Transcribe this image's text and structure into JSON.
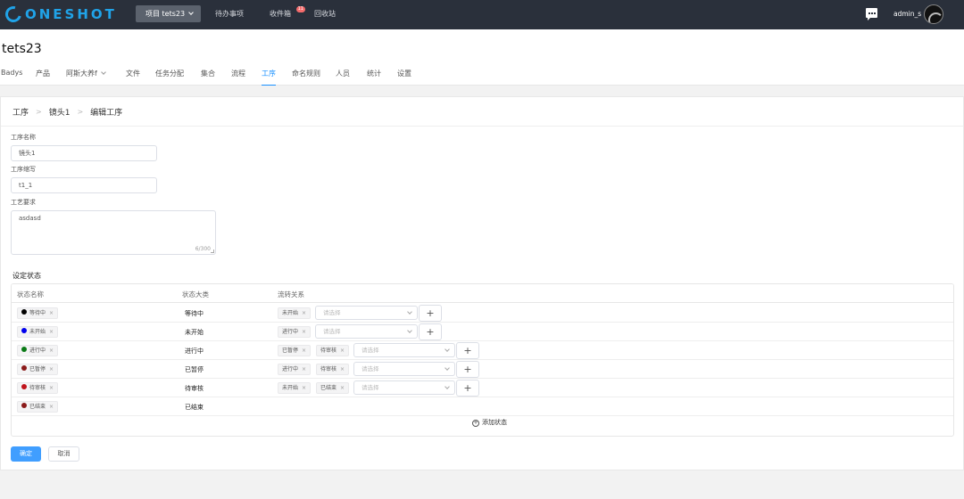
{
  "header": {
    "logo_text": "ONESHOT",
    "project_label": "项目 tets23",
    "todo_label": "待办事项",
    "inbox_label": "收件箱",
    "inbox_badge": "11",
    "recycle_label": "回收站",
    "username": "admin_s"
  },
  "project": {
    "title": "tets23",
    "tabs": [
      {
        "label": "Badys"
      },
      {
        "label": "产品"
      },
      {
        "label": "阿斯大养f"
      },
      {
        "label": "文件"
      },
      {
        "label": "任务分配"
      },
      {
        "label": "集合"
      },
      {
        "label": "流程"
      },
      {
        "label": "工序"
      },
      {
        "label": "命名规则"
      },
      {
        "label": "人员"
      },
      {
        "label": "统计"
      },
      {
        "label": "设置"
      }
    ]
  },
  "breadcrumb": [
    "工序",
    "镜头1",
    "编辑工序"
  ],
  "form": {
    "name_label": "工序名称",
    "name_value": "镜头1",
    "abbr_label": "工序缩写",
    "abbr_value": "t1_1",
    "req_label": "工艺要求",
    "req_value": "asdasd",
    "req_counter": "6/300"
  },
  "states": {
    "section_title": "设定状态",
    "columns": [
      "状态名称",
      "状态大类",
      "流转关系"
    ],
    "select_placeholder": "请选择",
    "remove_glyph": "×",
    "add_glyph": "+",
    "rows": [
      {
        "name": "等待中",
        "color": "#000000",
        "category": "等待中",
        "transitions": [
          "未开始"
        ]
      },
      {
        "name": "未开始",
        "color": "#0000ee",
        "category": "未开始",
        "transitions": [
          "进行中"
        ]
      },
      {
        "name": "进行中",
        "color": "#0a7a16",
        "category": "进行中",
        "transitions": [
          "已暂停",
          "待审核"
        ]
      },
      {
        "name": "已暂停",
        "color": "#8b1a1a",
        "category": "已暂停",
        "transitions": [
          "进行中",
          "待审核"
        ]
      },
      {
        "name": "待审核",
        "color": "#c0141c",
        "category": "待审核",
        "transitions": [
          "未开始",
          "已结束"
        ]
      },
      {
        "name": "已结束",
        "color": "#8b1a1a",
        "category": "已结束",
        "transitions": []
      }
    ],
    "add_state_label": "添加状态"
  },
  "actions": {
    "confirm_label": "确定",
    "cancel_label": "取消"
  }
}
